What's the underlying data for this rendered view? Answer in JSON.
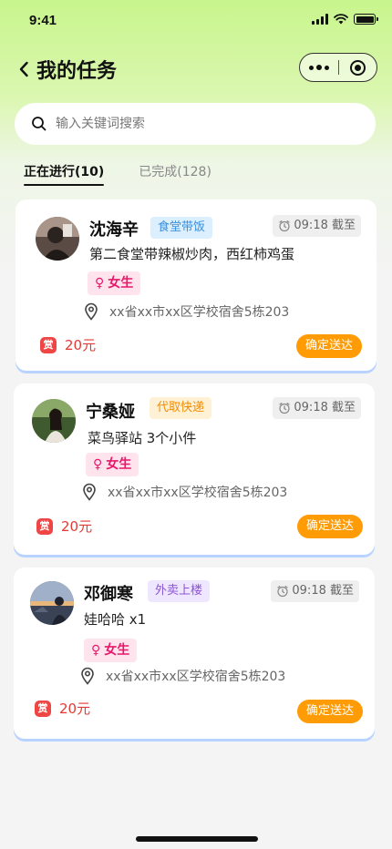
{
  "status_bar": {
    "time": "9:41"
  },
  "nav": {
    "title": "我的任务"
  },
  "search": {
    "placeholder": "输入关键词搜索"
  },
  "tabs": [
    {
      "label": "正在进行(10)",
      "active": true
    },
    {
      "label": "已完成(128)",
      "active": false
    }
  ],
  "tasks": [
    {
      "name": "沈海辛",
      "category": "食堂带饭",
      "deadline": "09:18 截至",
      "description": "第二食堂带辣椒炒肉，西红柿鸡蛋",
      "gender": "女生",
      "address": "xx省xx市xx区学校宿舍5栋203",
      "reward_badge": "赏",
      "reward": "20元",
      "action_label": "确定送达"
    },
    {
      "name": "宁桑娅",
      "category": "代取快递",
      "deadline": "09:18 截至",
      "description": "菜鸟驿站 3个小件",
      "gender": "女生",
      "address": "xx省xx市xx区学校宿舍5栋203",
      "reward_badge": "赏",
      "reward": "20元",
      "action_label": "确定送达"
    },
    {
      "name": "邓御寒",
      "category": "外卖上楼",
      "deadline": "09:18 截至",
      "description": "娃哈哈 x1",
      "gender": "女生",
      "address": "xx省xx市xx区学校宿舍5栋203",
      "reward_badge": "赏",
      "reward": "20元",
      "action_label": "确定送达"
    }
  ],
  "colors": {
    "accent_green": "#c8f58c",
    "tag_canteen_bg": "#dceffe",
    "tag_canteen_text": "#3a8fdc",
    "tag_express_bg": "#fff1d6",
    "tag_express_text": "#f08c00",
    "tag_takeout_bg": "#efe6ff",
    "tag_takeout_text": "#8a55d6",
    "gender_bg": "#ffe4ee",
    "gender_text": "#e8176a",
    "reward_red": "#e53935",
    "button_orange": "#ff9c05"
  }
}
